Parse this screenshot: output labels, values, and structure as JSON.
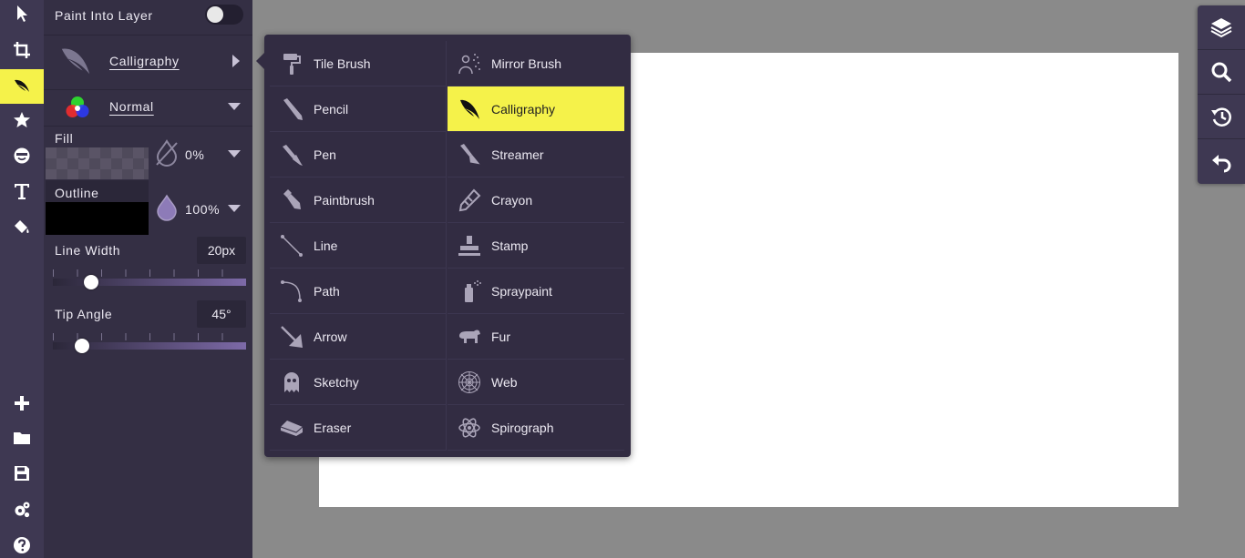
{
  "toolbar": {
    "tools": [
      {
        "name": "select-tool",
        "icon": "arrow-cursor-icon"
      },
      {
        "name": "crop-tool",
        "icon": "crop-icon"
      },
      {
        "name": "draw-tool",
        "icon": "quill-icon",
        "active": true
      },
      {
        "name": "sticker-tool",
        "icon": "star-icon"
      },
      {
        "name": "face-tool",
        "icon": "face-icon"
      },
      {
        "name": "text-tool",
        "icon": "text-t-icon"
      },
      {
        "name": "fill-tool",
        "icon": "paint-bucket-icon"
      }
    ],
    "bottom": [
      {
        "name": "new-button",
        "icon": "plus-icon"
      },
      {
        "name": "open-button",
        "icon": "folder-icon"
      },
      {
        "name": "save-button",
        "icon": "floppy-disk-icon"
      },
      {
        "name": "settings-button",
        "icon": "gears-icon"
      },
      {
        "name": "help-button",
        "icon": "question-icon"
      }
    ]
  },
  "props": {
    "paint_into_layer_label": "Paint Into Layer",
    "paint_into_layer_on": false,
    "brush_label": "Calligraphy",
    "blend_label": "Normal",
    "fill_label": "Fill",
    "fill_value": "0%",
    "outline_label": "Outline",
    "outline_value": "100%",
    "line_width_label": "Line Width",
    "line_width_value": "20px",
    "line_width_fraction": 0.2,
    "tip_angle_label": "Tip Angle",
    "tip_angle_value": "45°",
    "tip_angle_fraction": 0.15
  },
  "brush_menu": {
    "left": [
      {
        "label": "Tile Brush",
        "icon": "paint-roller-icon"
      },
      {
        "label": "Pencil",
        "icon": "pencil-icon"
      },
      {
        "label": "Pen",
        "icon": "pen-icon"
      },
      {
        "label": "Paintbrush",
        "icon": "paintbrush-icon"
      },
      {
        "label": "Line",
        "icon": "line-icon"
      },
      {
        "label": "Path",
        "icon": "path-icon"
      },
      {
        "label": "Arrow",
        "icon": "arrow-icon"
      },
      {
        "label": "Sketchy",
        "icon": "ghost-icon"
      },
      {
        "label": "Eraser",
        "icon": "eraser-icon"
      }
    ],
    "right": [
      {
        "label": "Mirror Brush",
        "icon": "mirror-brush-icon"
      },
      {
        "label": "Calligraphy",
        "icon": "quill-icon",
        "selected": true
      },
      {
        "label": "Streamer",
        "icon": "streamer-icon"
      },
      {
        "label": "Crayon",
        "icon": "crayon-icon"
      },
      {
        "label": "Stamp",
        "icon": "stamp-icon"
      },
      {
        "label": "Spraypaint",
        "icon": "spray-can-icon"
      },
      {
        "label": "Fur",
        "icon": "bear-icon"
      },
      {
        "label": "Web",
        "icon": "spider-web-icon"
      },
      {
        "label": "Spirograph",
        "icon": "atom-icon"
      }
    ]
  },
  "rail": [
    {
      "name": "layers-button",
      "icon": "layers-icon"
    },
    {
      "name": "zoom-button",
      "icon": "magnifier-icon"
    },
    {
      "name": "history-button",
      "icon": "history-icon"
    },
    {
      "name": "undo-button",
      "icon": "undo-icon"
    }
  ],
  "colors": {
    "accent": "#f5f24a",
    "toolbar_bg": "#3e3852",
    "panel_bg": "#342f44",
    "menu_bg": "#322c42",
    "workspace_bg": "#8a8a8a",
    "canvas_bg": "#ffffff"
  }
}
